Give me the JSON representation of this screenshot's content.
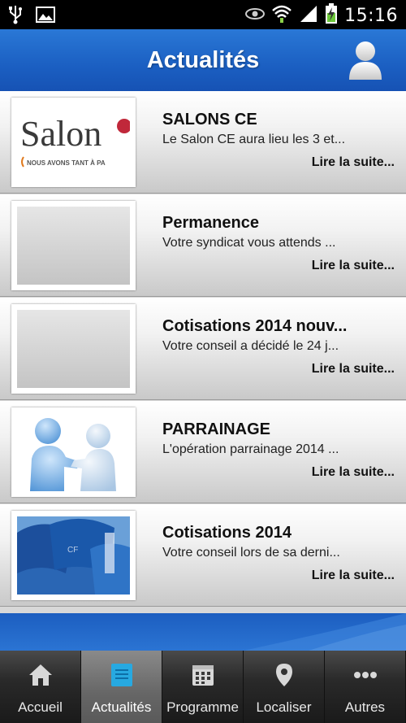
{
  "status_bar": {
    "time": "15:16",
    "icons": [
      "usb-icon",
      "image-icon",
      "eye-icon",
      "wifi-icon",
      "signal-icon",
      "battery-charging-icon"
    ]
  },
  "header": {
    "title": "Actualités",
    "profile_icon": "user-profile-icon"
  },
  "news": [
    {
      "title": "SALONS CE",
      "excerpt": "Le Salon CE  aura lieu les 3 et...",
      "more": "Lire la suite...",
      "thumb_text_main": "Salon",
      "thumb_text_tag": "NOUS AVONS TANT À PA"
    },
    {
      "title": "Permanence",
      "excerpt": "Votre syndicat vous attends ...",
      "more": "Lire la suite..."
    },
    {
      "title": "Cotisations 2014 nouv...",
      "excerpt": "Votre conseil a décidé le 24 j...",
      "more": "Lire la suite..."
    },
    {
      "title": "PARRAINAGE",
      "excerpt": "L'opération parrainage 2014 ...",
      "more": "Lire la suite..."
    },
    {
      "title": "Cotisations 2014",
      "excerpt": "Votre conseil lors de sa derni...",
      "more": "Lire la suite..."
    }
  ],
  "tabs": [
    {
      "label": "Accueil",
      "icon": "home-icon",
      "active": false
    },
    {
      "label": "Actualités",
      "icon": "news-icon",
      "active": true
    },
    {
      "label": "Programme",
      "icon": "calendar-icon",
      "active": false
    },
    {
      "label": "Localiser",
      "icon": "location-pin-icon",
      "active": false
    },
    {
      "label": "Autres",
      "icon": "more-icon",
      "active": false
    }
  ],
  "colors": {
    "header_blue": "#1b5fc2",
    "tab_active": "#666666",
    "accent_cyan": "#27a9e1"
  }
}
